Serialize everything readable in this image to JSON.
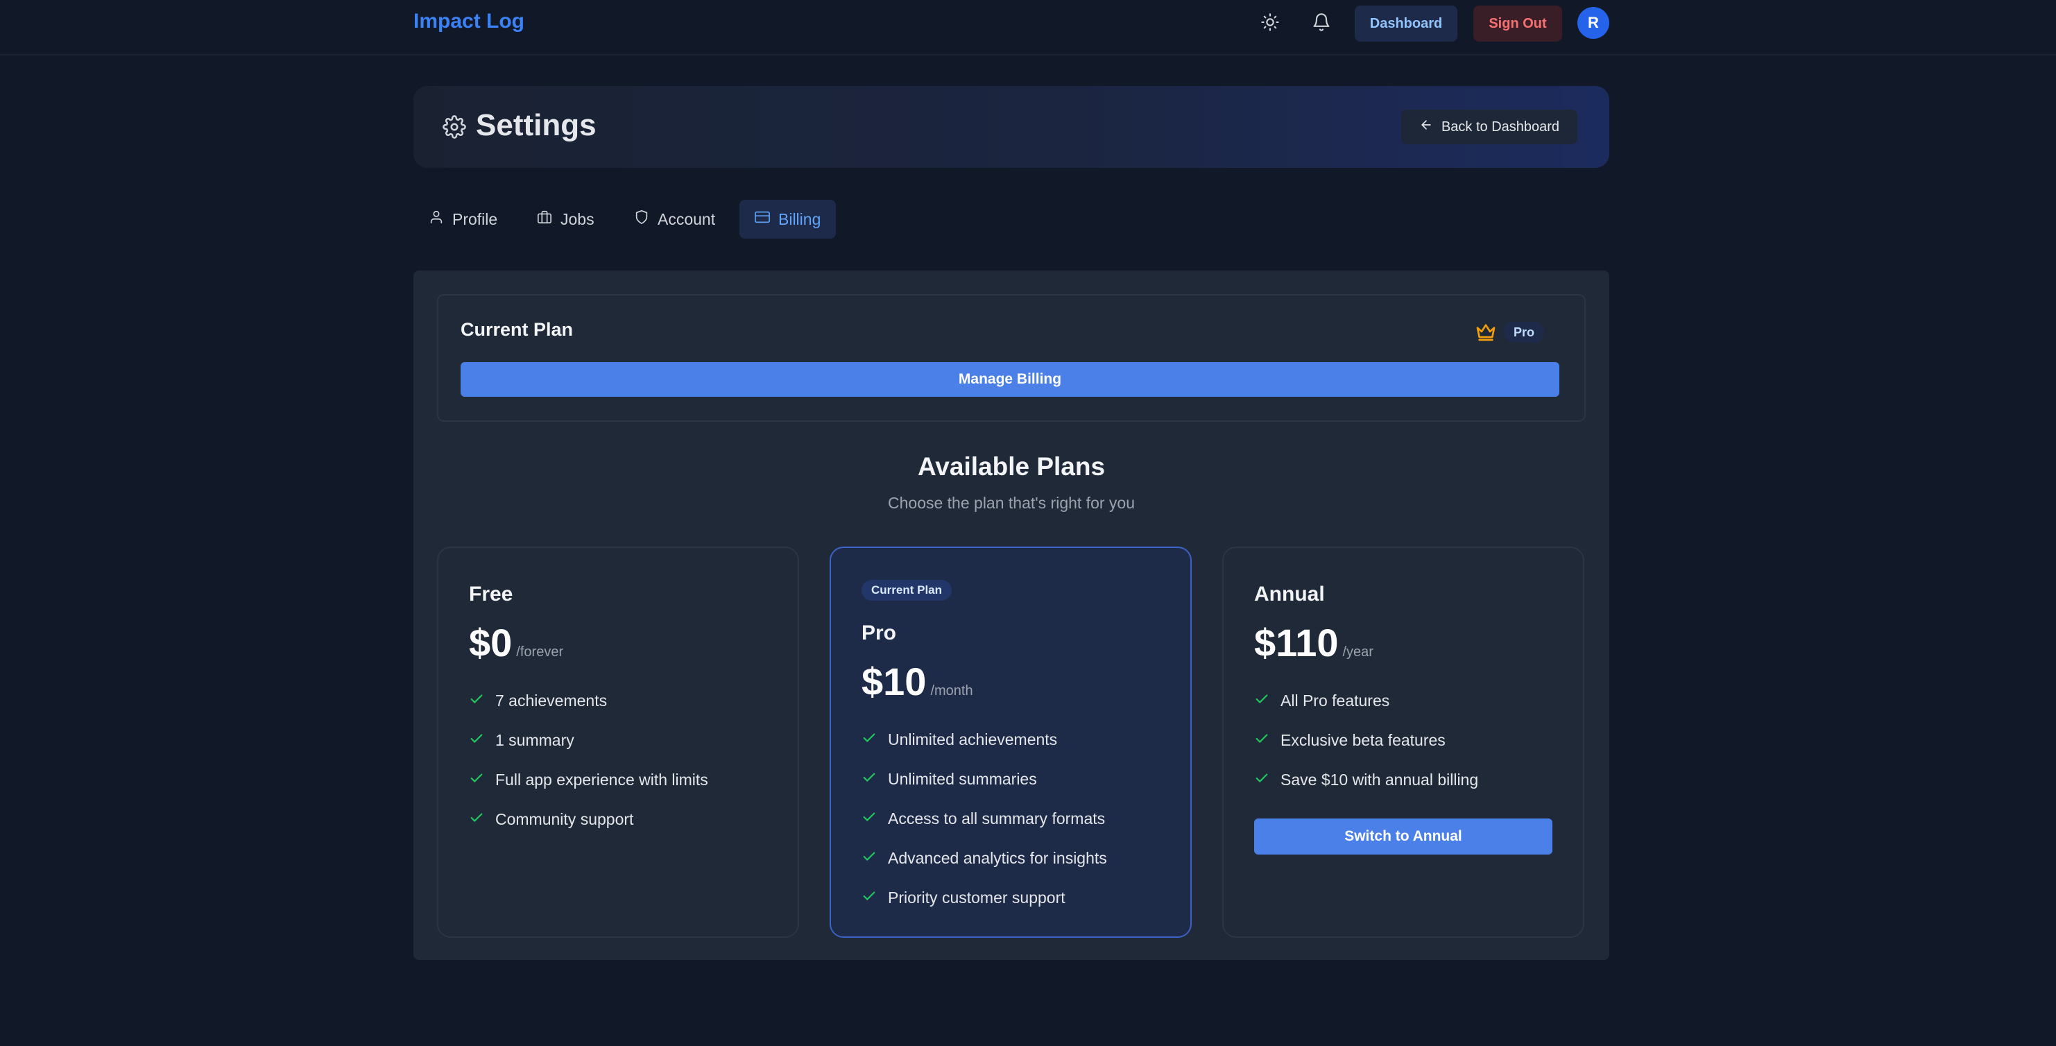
{
  "nav": {
    "brand": "Impact Log",
    "dashboard_label": "Dashboard",
    "signout_label": "Sign Out",
    "avatar_initial": "R",
    "icons": [
      "sun-icon",
      "bell-icon"
    ]
  },
  "header": {
    "title": "Settings",
    "back_label": "Back to Dashboard"
  },
  "tabs": [
    {
      "label": "Profile",
      "icon": "user-icon",
      "active": false
    },
    {
      "label": "Jobs",
      "icon": "briefcase-icon",
      "active": false
    },
    {
      "label": "Account",
      "icon": "shield-icon",
      "active": false
    },
    {
      "label": "Billing",
      "icon": "credit-card-icon",
      "active": true
    }
  ],
  "current_plan": {
    "title": "Current Plan",
    "badge": "Pro",
    "manage_label": "Manage Billing"
  },
  "plans_section": {
    "title": "Available Plans",
    "subtitle": "Choose the plan that's right for you"
  },
  "plans": [
    {
      "name": "Free",
      "price": "$0",
      "period": "/forever",
      "features": [
        "7 achievements",
        "1 summary",
        "Full app experience with limits",
        "Community support"
      ]
    },
    {
      "label": "Current Plan",
      "name": "Pro",
      "price": "$10",
      "period": "/month",
      "features": [
        "Unlimited achievements",
        "Unlimited summaries",
        "Access to all summary formats",
        "Advanced analytics for insights",
        "Priority customer support"
      ]
    },
    {
      "name": "Annual",
      "price": "$110",
      "period": "/year",
      "features": [
        "All Pro features",
        "Exclusive beta features",
        "Save $10 with annual billing"
      ],
      "button_label": "Switch to Annual"
    }
  ],
  "colors": {
    "background": "#111827",
    "panel": "#1f2937",
    "accent": "#4a80e8",
    "brand": "#3b82f6",
    "check": "#22c55e",
    "crown": "#f59e0b",
    "signout": "#f87171"
  }
}
